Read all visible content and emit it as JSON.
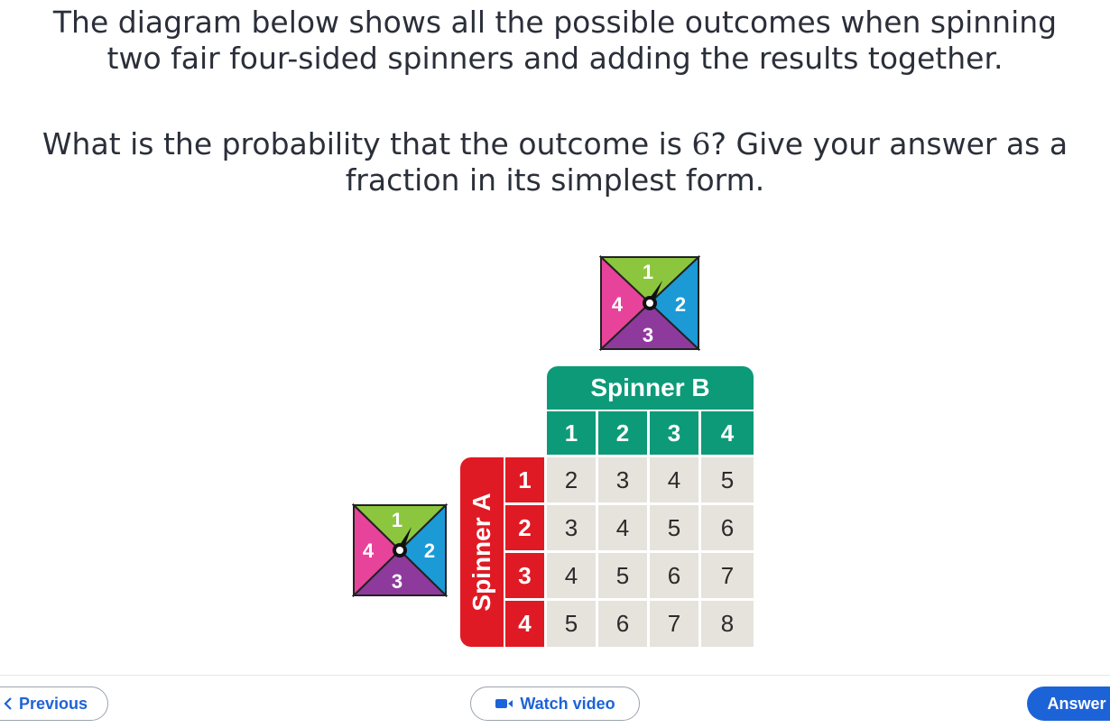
{
  "question": {
    "line1": "The diagram below shows all the possible outcomes when spinning",
    "line2": "two fair four-sided spinners and adding the results together.",
    "line3_pre": "What is the probability that the outcome is ",
    "line3_num": "6",
    "line3_post": "? Give your answer as a",
    "line4": "fraction in its simplest form."
  },
  "spinner_b": {
    "top": "1",
    "right": "2",
    "bottom": "3",
    "left": "4"
  },
  "spinner_a": {
    "top": "1",
    "right": "2",
    "bottom": "3",
    "left": "4"
  },
  "table": {
    "b_title": "Spinner B",
    "a_title": "Spinner A",
    "b_values": [
      "1",
      "2",
      "3",
      "4"
    ],
    "a_values": [
      "1",
      "2",
      "3",
      "4"
    ],
    "sums": [
      [
        "2",
        "3",
        "4",
        "5"
      ],
      [
        "3",
        "4",
        "5",
        "6"
      ],
      [
        "4",
        "5",
        "6",
        "7"
      ],
      [
        "5",
        "6",
        "7",
        "8"
      ]
    ]
  },
  "colors": {
    "green": "#8cc63f",
    "blue": "#1b9ad6",
    "purple": "#8e3a9d",
    "pink": "#e8439a",
    "teal": "#0d9a78",
    "red": "#e01a24",
    "cell": "#e6e3dd",
    "accent": "#1d63d8"
  },
  "nav": {
    "previous_label": "Previous",
    "watch_label": "Watch video",
    "answer_label": "Answer"
  },
  "icons": {
    "previous": "chevron-left-icon",
    "watch": "video-camera-icon"
  }
}
